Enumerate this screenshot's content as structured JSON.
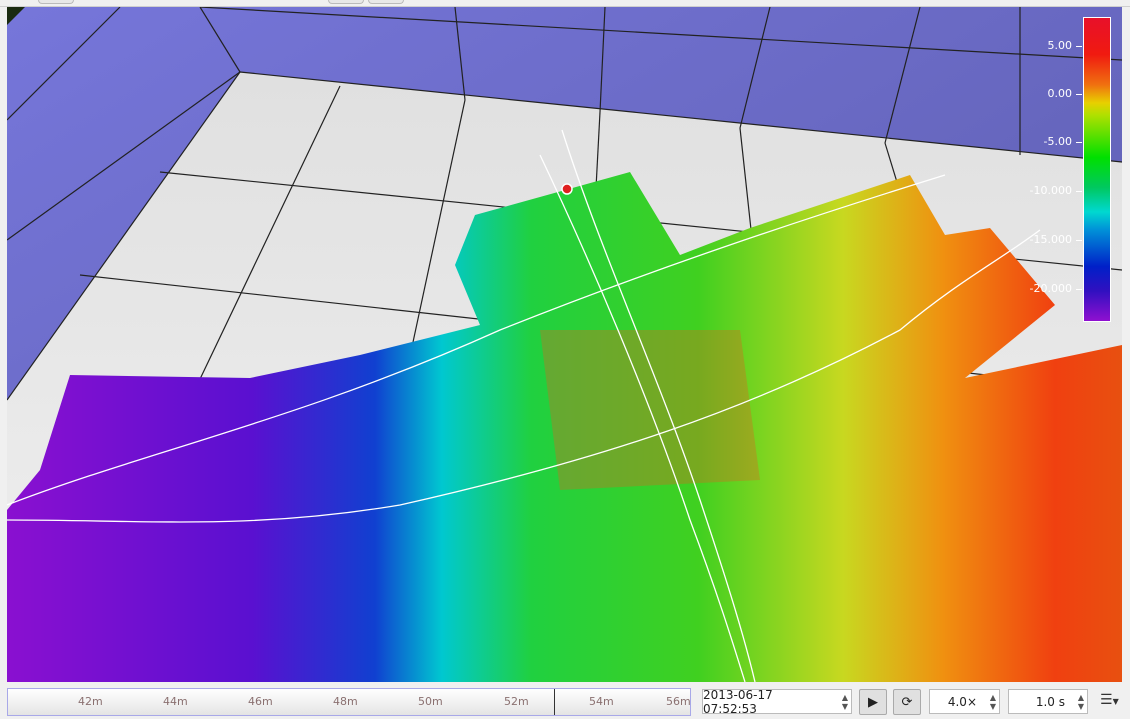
{
  "legend": {
    "labels": [
      "5.00",
      "0.00",
      "-5.00",
      "-10.000",
      "-15.000",
      "-20.000"
    ]
  },
  "timeline": {
    "ticks": [
      "42m",
      "44m",
      "46m",
      "48m",
      "50m",
      "52m",
      "54m",
      "56m"
    ],
    "position_fraction": 0.8
  },
  "datetime": "2013-06-17 07:52:53",
  "speed": "4.0×",
  "interval": "1.0 s",
  "icons": {
    "play": "play-icon",
    "loop": "loop-icon",
    "menu": "menu-icon"
  }
}
